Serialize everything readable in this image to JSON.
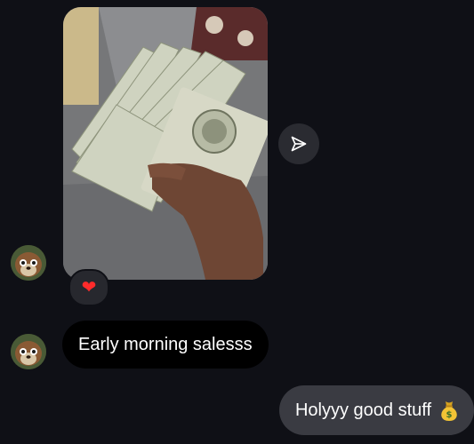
{
  "messages": [
    {
      "direction": "incoming",
      "type": "photo",
      "reaction": "❤"
    },
    {
      "direction": "incoming",
      "type": "text",
      "text": "Early morning salesss"
    },
    {
      "direction": "outgoing",
      "type": "text",
      "text": "Holyyy good stuff",
      "emoji": "money-bag"
    }
  ],
  "icons": {
    "share": "paper-plane-icon",
    "reaction": "heart-icon",
    "emoji": "money-bag-icon"
  },
  "colors": {
    "background": "#0f1016",
    "incoming_bubble": "#000000",
    "outgoing_bubble": "#3a3b42",
    "reaction_heart": "#ff2b2b"
  }
}
